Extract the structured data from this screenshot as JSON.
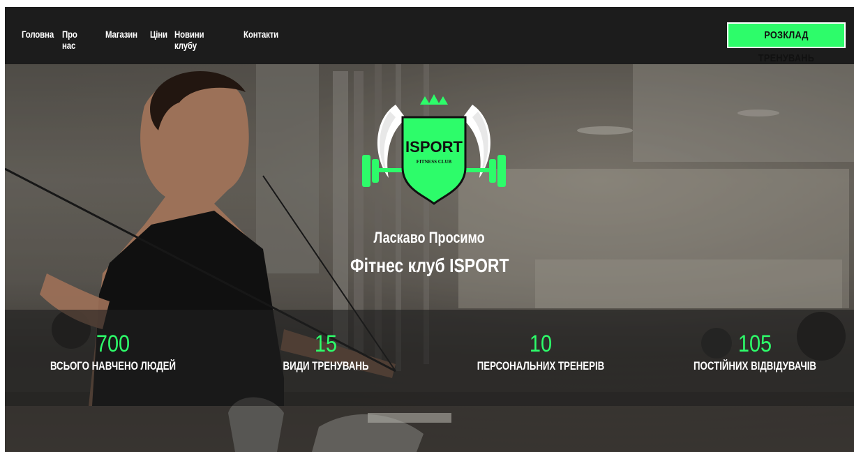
{
  "nav": {
    "links": [
      "Головна",
      "Про нас",
      "Магазин",
      "Ціни",
      "Новини клубу",
      "Контакти"
    ],
    "schedule_button": "РОЗКЛАД ТРЕНУВАНЬ"
  },
  "logo": {
    "title": "ISPORT",
    "subtitle": "FITNESS CLUB"
  },
  "hero": {
    "welcome_line_1": "Ласкаво Просимо",
    "welcome_line_2": "Фітнес клуб ISPORT"
  },
  "stats": [
    {
      "value": "700",
      "label": "ВСЬОГО НАВЧЕНО ЛЮДЕЙ"
    },
    {
      "value": "15",
      "label": "ВИДИ ТРЕНУВАНЬ"
    },
    {
      "value": "10",
      "label": "ПЕРСОНАЛЬНИХ ТРЕНЕРІВ"
    },
    {
      "value": "105",
      "label": "ПОСТІЙНИХ ВІДВІДУВАЧІВ"
    }
  ],
  "colors": {
    "accent": "#2dfc6a",
    "nav_background": "#1c1c1c",
    "text": "#ffffff"
  }
}
